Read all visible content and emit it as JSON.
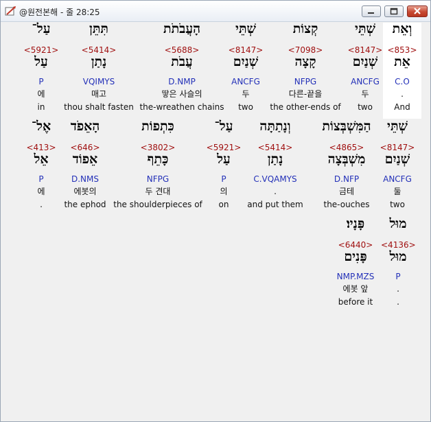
{
  "window": {
    "title": "@원전본해 - 줄 28:25"
  },
  "lines": [
    {
      "words": [
        {
          "heb1": "וְאֵת",
          "num": "<853>",
          "heb2": "אֵת",
          "morph": "C.O",
          "kor": ".",
          "eng": "And",
          "selected": true
        },
        {
          "heb1": "שְׁתֵּי",
          "num": "<8147>",
          "heb2": "שְׁנַיִם",
          "morph": "ANCFG",
          "kor": "두",
          "eng": "two"
        },
        {
          "heb1": "קְצוֹת",
          "num": "<7098>",
          "heb2": "קָצָה",
          "morph": "NFPG",
          "kor": "다른-끝을",
          "eng": "the other-ends of"
        },
        {
          "heb1": "שְׁתֵּי",
          "num": "<8147>",
          "heb2": "שְׁנַיִם",
          "morph": "ANCFG",
          "kor": "두",
          "eng": "two"
        },
        {
          "heb1": "הָעֲבֹתֹת",
          "num": "<5688>",
          "heb2": "עֲבֹת",
          "morph": "D.NMP",
          "kor": "땋은 사슬의",
          "eng": "the-wreathen chains"
        },
        {
          "heb1": "תִּתֵּן",
          "num": "<5414>",
          "heb2": "נָתַן",
          "morph": "VQIMYS",
          "kor": "매고",
          "eng": "thou shalt fasten"
        },
        {
          "heb1": "עַל־",
          "num": "<5921>",
          "heb2": "עַל",
          "morph": "P",
          "kor": "에",
          "eng": "in"
        }
      ]
    },
    {
      "words": [
        {
          "heb1": "שְׁתֵּי",
          "num": "<8147>",
          "heb2": "שְׁנַיִם",
          "morph": "ANCFG",
          "kor": "둘",
          "eng": "two"
        },
        {
          "heb1": "הַמִּשְׁבְּצוֹת",
          "num": "<4865>",
          "heb2": "מִשְׁבְּצָה",
          "morph": "D.NFP",
          "kor": "금테",
          "eng": "the-ouches"
        },
        {
          "heb1": "וְנָתַתָּה",
          "num": "<5414>",
          "heb2": "נָתַן",
          "morph": "C.VQAMYS",
          "kor": ".",
          "eng": "and put them"
        },
        {
          "heb1": "עַל־",
          "num": "<5921>",
          "heb2": "עַל",
          "morph": "P",
          "kor": "의",
          "eng": "on"
        },
        {
          "heb1": "כִּתְפוֹת",
          "num": "<3802>",
          "heb2": "כָּתֵף",
          "morph": "NFPG",
          "kor": "두 견대",
          "eng": "the shoulderpieces of"
        },
        {
          "heb1": "הָאֵפֹד",
          "num": "<646>",
          "heb2": "אֵפוֹד",
          "morph": "D.NMS",
          "kor": "에봇의",
          "eng": "the ephod"
        },
        {
          "heb1": "אֶל־",
          "num": "<413>",
          "heb2": "אֵל",
          "morph": "P",
          "kor": "에",
          "eng": "."
        }
      ]
    },
    {
      "words": [
        {
          "heb1": "מוּל",
          "num": "<4136>",
          "heb2": "מוּל",
          "morph": "P",
          "kor": ".",
          "eng": "."
        },
        {
          "heb1": "פָּנָיו׃",
          "num": "<6440>",
          "heb2": "פָּנִים",
          "morph": "NMP.MZS",
          "kor": "에봇 앞",
          "eng": "before it"
        }
      ]
    }
  ]
}
